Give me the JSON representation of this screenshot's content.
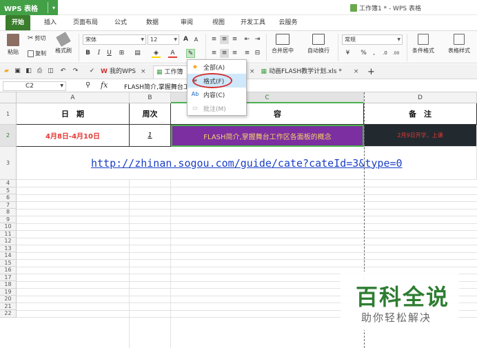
{
  "titlebar": {
    "app_label": "WPS 表格",
    "doc_title": "工作簿1 * - WPS 表格"
  },
  "menu": [
    "开始",
    "插入",
    "页面布局",
    "公式",
    "数据",
    "审阅",
    "视图",
    "开发工具",
    "云服务"
  ],
  "ribbon": {
    "paste": "粘贴",
    "cut": "剪切",
    "copy": "复制",
    "format_painter": "格式刷",
    "font_name": "宋体",
    "font_size": "12",
    "bold": "B",
    "italic": "I",
    "underline": "U",
    "grow_font": "A",
    "shrink_font": "A",
    "merge_center": "合并居中",
    "wrap_text": "自动换行",
    "number_format": "常规",
    "percent": "%",
    "comma": ",",
    "inc_decimal": ".0",
    "dec_decimal": ".00",
    "conditional_format": "条件格式",
    "table_style": "表格样式"
  },
  "doc_tabs": [
    {
      "label": "我的WPS",
      "close": "×"
    },
    {
      "label": "工作簿",
      "close": "×"
    },
    {
      "label": "动画FLASH教学计划.xls *",
      "close": "×"
    }
  ],
  "new_tab": "+",
  "formula_bar": {
    "name_box": "C2",
    "fx": "fx",
    "content": "FLASH简介,掌握舞台工作区各面板的概念"
  },
  "columns": [
    "A",
    "B",
    "C",
    "D"
  ],
  "rows": [
    "1",
    "2",
    "3",
    "4",
    "5",
    "6",
    "7",
    "8",
    "9",
    "10",
    "11",
    "12",
    "13",
    "14",
    "15",
    "16",
    "17",
    "18",
    "19",
    "20",
    "21",
    "22"
  ],
  "cells": {
    "a1": "日　期",
    "b1": "周次",
    "c1": "容",
    "d1": "备　注",
    "a2": "4月8日-4月10日",
    "b2": "1",
    "c2": "FLASH简介,掌握舞台工作区各面板的概念",
    "d2": "2月9日开学，上课",
    "c3_link": "http://zhinan.sogou.com/guide/cate?cateId=3&type=0"
  },
  "dropdown": [
    {
      "label": "全部(A)",
      "disabled": false
    },
    {
      "label": "格式(F)",
      "disabled": false
    },
    {
      "label": "内容(C)",
      "disabled": false
    },
    {
      "label": "批注(M)",
      "disabled": true
    }
  ],
  "watermark": {
    "title": "百科全说",
    "subtitle": "助你轻松解决"
  },
  "colors": {
    "wps_green": "#43a047",
    "active_tab": "#3a7d2c",
    "purple_fill": "#7b2fa0",
    "purple_text": "#f5d06a",
    "dark_fill": "#222a30",
    "red_text": "#e53935",
    "link_blue": "#1a3fc6",
    "ring_red": "#d32f2f",
    "watermark_green": "#2e7d32"
  }
}
